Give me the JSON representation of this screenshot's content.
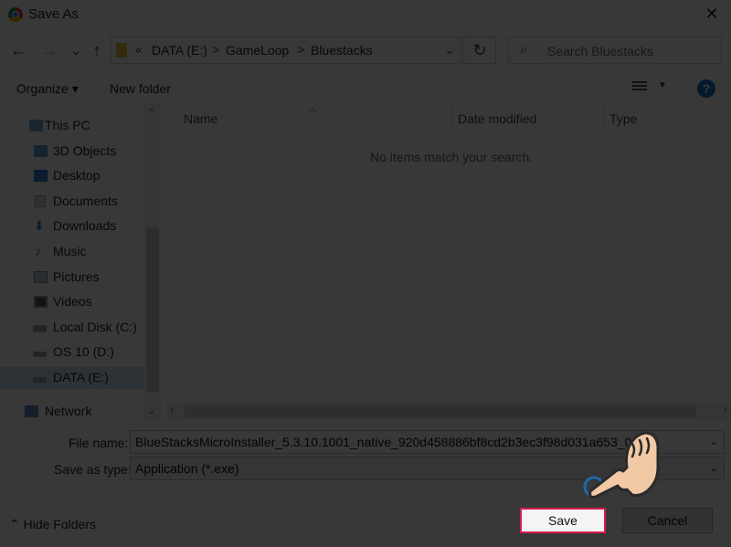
{
  "window": {
    "title": "Save As",
    "close_glyph": "✕"
  },
  "nav": {
    "back": "←",
    "forward": "→",
    "recent": "⌄",
    "up": "↑"
  },
  "address": {
    "prefix": "«",
    "crumbs": [
      "DATA (E:)",
      "GameLoop",
      "Bluestacks"
    ],
    "sep": ">",
    "dropdown": "⌄",
    "refresh": "↻"
  },
  "search": {
    "placeholder": "Search Bluestacks",
    "icon": "⌕"
  },
  "toolbar": {
    "organize": "Organize ▾",
    "new_folder": "New folder",
    "view_arrow": "▼",
    "help": "?"
  },
  "sidebar": {
    "items": [
      {
        "label": "This PC",
        "icon": "pc-icon"
      },
      {
        "label": "3D Objects",
        "icon": "cube-icon"
      },
      {
        "label": "Desktop",
        "icon": "desktop-icon"
      },
      {
        "label": "Documents",
        "icon": "document-icon"
      },
      {
        "label": "Downloads",
        "icon": "download-icon"
      },
      {
        "label": "Music",
        "icon": "music-icon"
      },
      {
        "label": "Pictures",
        "icon": "pictures-icon"
      },
      {
        "label": "Videos",
        "icon": "videos-icon"
      },
      {
        "label": "Local Disk (C:)",
        "icon": "drive-icon"
      },
      {
        "label": "OS 10 (D:)",
        "icon": "drive-icon"
      },
      {
        "label": "DATA (E:)",
        "icon": "drive-icon"
      },
      {
        "label": "Network",
        "icon": "network-icon"
      }
    ],
    "selected": "DATA (E:)"
  },
  "filelist": {
    "columns": [
      "Name",
      "Date modified",
      "Type"
    ],
    "empty_message": "No items match your search."
  },
  "fields": {
    "file_name_label": "File name:",
    "file_name_value": "BlueStacksMicroInstaller_5.3.10.1001_native_920d458886bf8cd2b3ec3f98d031a653_0",
    "save_as_type_label": "Save as type:",
    "save_as_type_value": "Application (*.exe)"
  },
  "footer": {
    "hide_folders": "Hide Folders",
    "save": "Save",
    "cancel": "Cancel"
  },
  "colors": {
    "highlight": "#d81b4e",
    "help_blue": "#1a73c9",
    "hand_skin": "#f2c9a5"
  }
}
